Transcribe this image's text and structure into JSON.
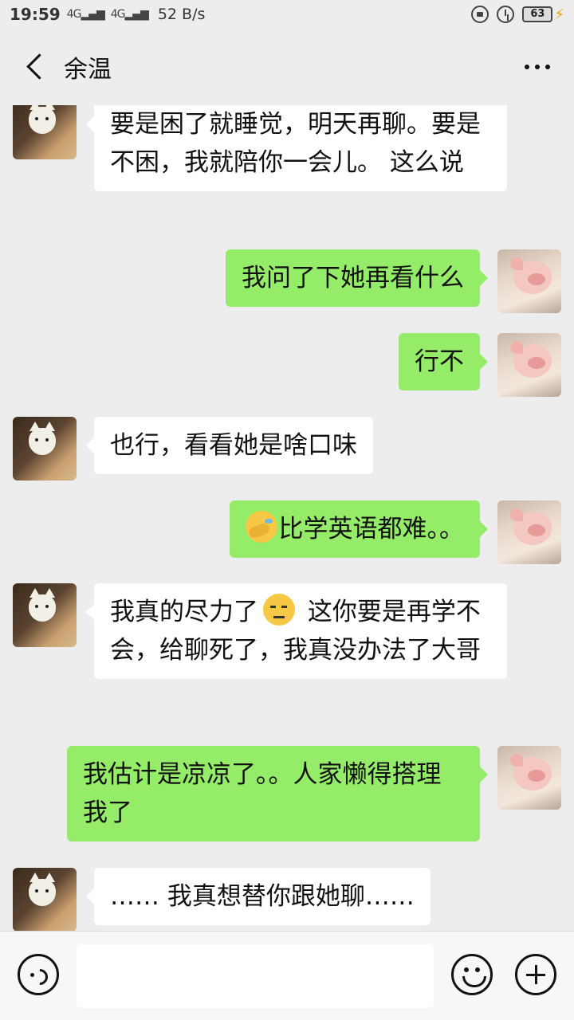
{
  "status_bar": {
    "time": "19:59",
    "signal1": "4G",
    "signal2": "4G",
    "speed": "52 B/s",
    "battery": "63",
    "icons": [
      "lock-rotation-icon",
      "alarm-icon",
      "battery-icon",
      "charging-icon"
    ]
  },
  "nav": {
    "title": "余温",
    "back_icon": "chevron-left-icon",
    "more_icon": "more-dots-icon"
  },
  "messages": [
    {
      "side": "left",
      "avatar": "cat-avatar",
      "text": "要是困了就睡觉，明天再聊。要是不困，我就陪你一会儿。 这么说"
    },
    {
      "side": "right",
      "avatar": "pig-avatar",
      "text": "我问了下她再看什么"
    },
    {
      "side": "right",
      "avatar": "pig-avatar",
      "text": "行不"
    },
    {
      "side": "left",
      "avatar": "cat-avatar",
      "text": "也行，看看她是啥口味"
    },
    {
      "side": "right",
      "avatar": "pig-avatar",
      "emoji": "facepalm-emoji",
      "text": "比学英语都难。。"
    },
    {
      "side": "left",
      "avatar": "cat-avatar",
      "text_before": "我真的尽力了",
      "emoji": "sweat-smile-emoji",
      "text_after": " 这你要是再学不会，给聊死了，我真没办法了大哥"
    },
    {
      "side": "right",
      "avatar": "pig-avatar",
      "text": "我估计是凉凉了。。人家懒得搭理我了"
    },
    {
      "side": "left",
      "avatar": "cat-avatar",
      "text": "…… 我真想替你跟她聊……"
    }
  ],
  "input_bar": {
    "voice_icon": "voice-icon",
    "placeholder": "",
    "emoji_icon": "emoji-icon",
    "plus_icon": "plus-icon"
  },
  "colors": {
    "background": "#ededed",
    "self_bubble": "#95ec69",
    "other_bubble": "#ffffff"
  }
}
